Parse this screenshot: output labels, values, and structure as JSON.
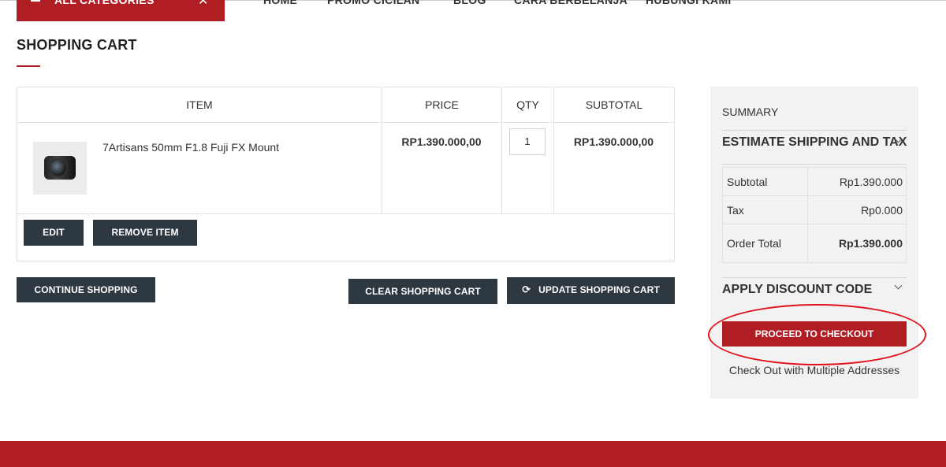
{
  "header": {
    "categories_label": "ALL CATEGORIES",
    "nav": [
      "HOME",
      "PROMO CICILAN",
      "BLOG",
      "CARA BERBELANJA",
      "HUBUNGI KAMI"
    ]
  },
  "page": {
    "title": "SHOPPING CART"
  },
  "cart": {
    "columns": {
      "item": "ITEM",
      "price": "PRICE",
      "qty": "QTY",
      "subtotal": "SUBTOTAL"
    },
    "items": [
      {
        "name": "7Artisans 50mm F1.8 Fuji FX Mount",
        "price": "RP1.390.000,00",
        "qty": "1",
        "subtotal": "RP1.390.000,00"
      }
    ],
    "edit_label": "EDIT",
    "remove_label": "REMOVE ITEM",
    "continue_label": "CONTINUE SHOPPING",
    "clear_label": "CLEAR SHOPPING CART",
    "update_label": "UPDATE SHOPPING CART"
  },
  "summary": {
    "title": "SUMMARY",
    "estimate_label": "ESTIMATE SHIPPING AND TAX",
    "rows": [
      {
        "label": "Subtotal",
        "value": "Rp1.390.000"
      },
      {
        "label": "Tax",
        "value": "Rp0.000"
      },
      {
        "label": "Order Total",
        "value": "Rp1.390.000"
      }
    ],
    "discount_label": "APPLY DISCOUNT CODE",
    "checkout_label": "PROCEED TO CHECKOUT",
    "multi_address_label": "Check Out with Multiple Addresses"
  },
  "colors": {
    "brand_red": "#b01e23",
    "dark_button": "#2d3841",
    "annotation_circle": "#e0121b"
  }
}
